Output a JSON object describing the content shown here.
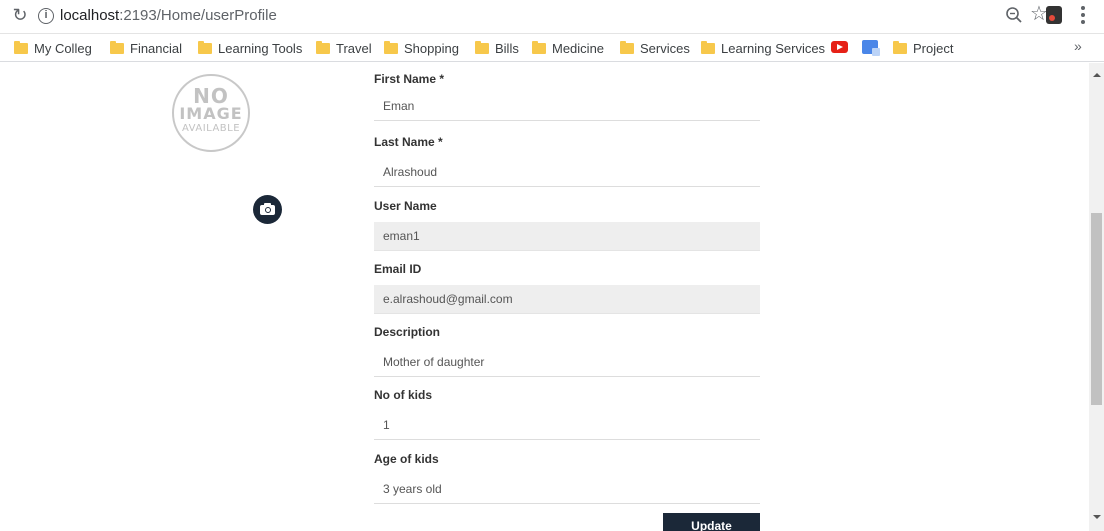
{
  "browser": {
    "url_host": "localhost",
    "url_path": ":2193/Home/userProfile",
    "overflow_label": "»"
  },
  "bookmarks": [
    {
      "label": "My Colleg",
      "icon": "folder-icon"
    },
    {
      "label": "Financial",
      "icon": "folder-icon"
    },
    {
      "label": "Learning Tools",
      "icon": "folder-icon"
    },
    {
      "label": "Travel",
      "icon": "folder-icon"
    },
    {
      "label": "Shopping",
      "icon": "folder-icon"
    },
    {
      "label": "Bills",
      "icon": "folder-icon"
    },
    {
      "label": "Medicine",
      "icon": "folder-icon"
    },
    {
      "label": "Services",
      "icon": "folder-icon"
    },
    {
      "label": "Learning Services",
      "icon": "folder-icon"
    },
    {
      "label": "Project",
      "icon": "folder-icon"
    }
  ],
  "profile_image": {
    "line1": "NO",
    "line2": "IMAGE",
    "line3": "AVAILABLE"
  },
  "form": {
    "first_name": {
      "label": "First Name *",
      "value": "Eman"
    },
    "last_name": {
      "label": "Last Name *",
      "value": "Alrashoud"
    },
    "user_name": {
      "label": "User Name",
      "value": "eman1"
    },
    "email": {
      "label": "Email ID",
      "value": "e.alrashoud@gmail.com"
    },
    "description": {
      "label": "Description",
      "value": "Mother of daughter"
    },
    "no_of_kids": {
      "label": "No of kids",
      "value": "1"
    },
    "age_of_kids": {
      "label": "Age of kids",
      "value": "3 years old"
    },
    "update_label": "Update"
  },
  "colors": {
    "button_bg": "#1b2838",
    "folder": "#f7c84b",
    "readonly_bg": "#eeeeee"
  }
}
